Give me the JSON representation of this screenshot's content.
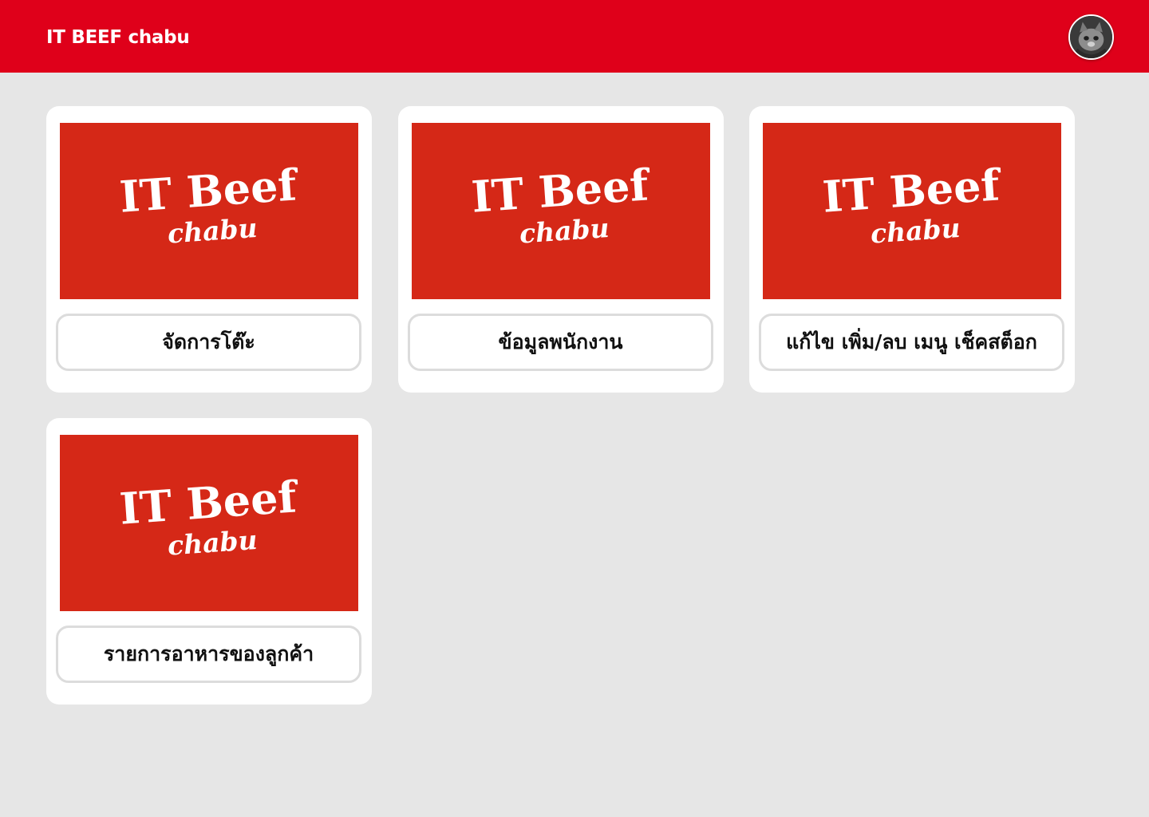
{
  "header": {
    "title": "IT BEEF chabu",
    "background_color": "#df001a",
    "avatar_icon": "user-avatar-cat-photo"
  },
  "brand": {
    "logo_line1": "IT Beef",
    "logo_line2": "chabu",
    "logo_background": "#d52817"
  },
  "menu": {
    "cards": [
      {
        "label": "จัดการโต๊ะ"
      },
      {
        "label": "ข้อมูลพนักงาน"
      },
      {
        "label": "แก้ไข เพิ่ม/ลบ เมนู เช็คสต็อก"
      },
      {
        "label": "รายการอาหารของลูกค้า"
      }
    ]
  }
}
